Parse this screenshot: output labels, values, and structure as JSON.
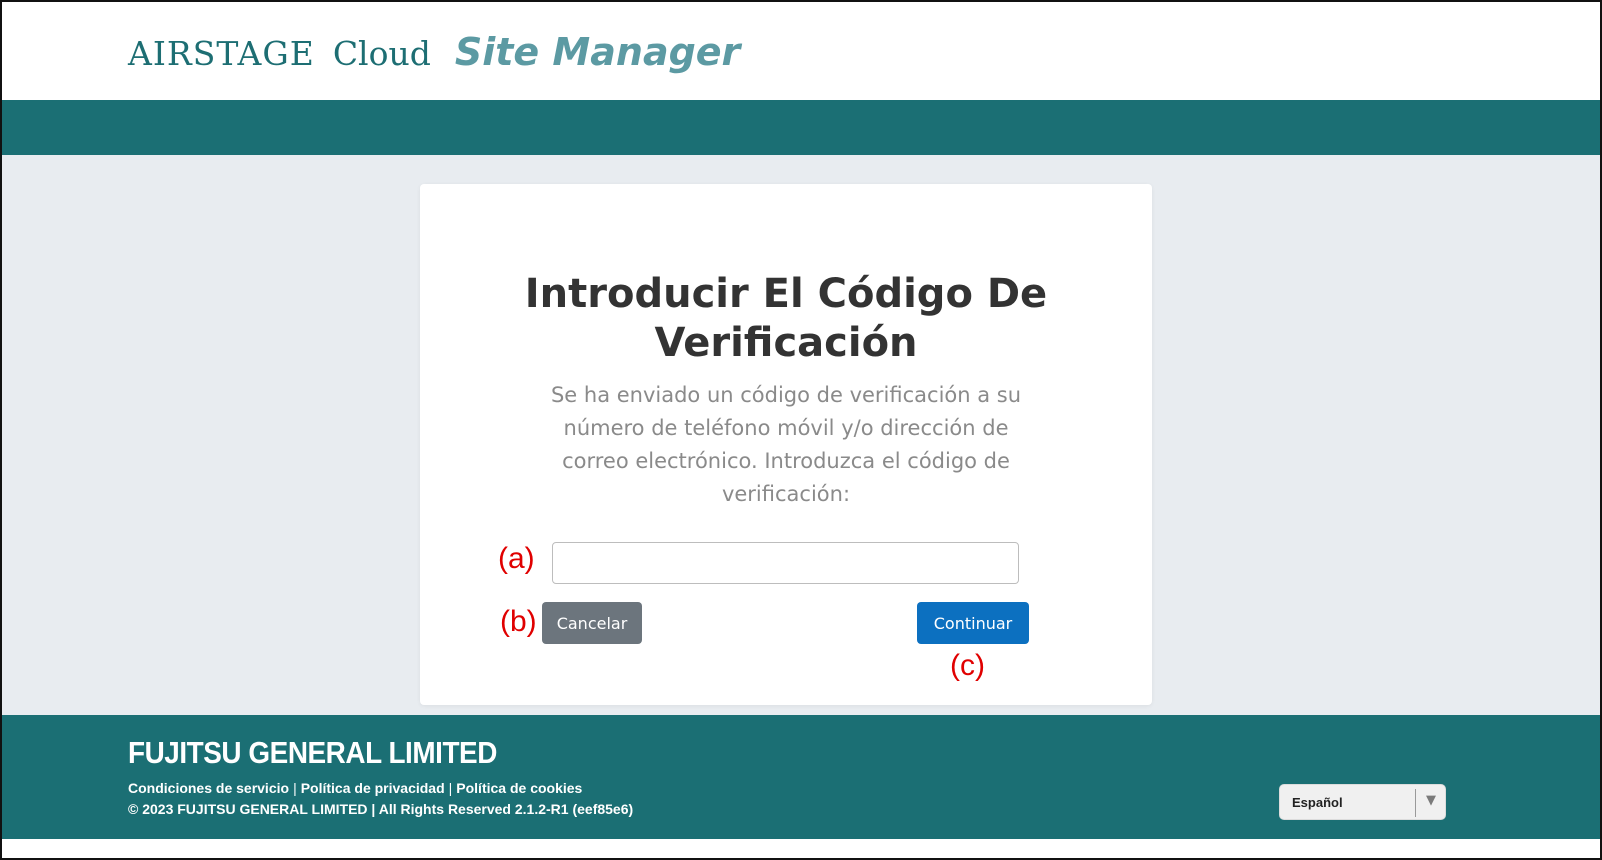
{
  "header": {
    "brand_airstage": "AIRSTAGE",
    "brand_cloud": "Cloud",
    "brand_site_manager": "Site Manager"
  },
  "card": {
    "title_line1": "Introducir El Código De",
    "title_line2": "Verificación",
    "description": "Se ha enviado un código de verificación a su número de teléfono móvil y/o dirección de correo electrónico. Introduzca el código de verificación:",
    "code_input_value": "",
    "cancel_label": "Cancelar",
    "continue_label": "Continuar"
  },
  "annotations": {
    "a": "(a)",
    "b": "(b)",
    "c": "(c)"
  },
  "footer": {
    "company": "FUJITSU GENERAL LIMITED",
    "links": [
      "Condiciones de servicio",
      "Política de privacidad",
      "Política de cookies"
    ],
    "copyright": "© 2023 FUJITSU GENERAL LIMITED | All Rights Reserved 2.1.2-R1 (eef85e6)",
    "language_selected": "Español",
    "language_arrow_icon": "triangle-down"
  },
  "colors": {
    "teal": "#1b6f74",
    "brand_teal": "#1d6e73",
    "site_manager": "#5c9aa3",
    "page_bg": "#e8ecf0",
    "cancel_button": "#6c757d",
    "continue_button": "#0c70c0",
    "annotation_red": "#e00000"
  }
}
